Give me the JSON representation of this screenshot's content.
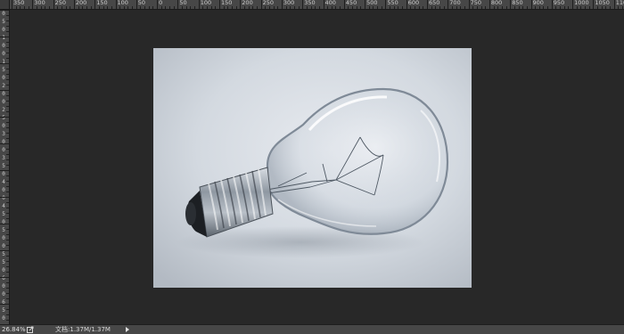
{
  "rulers": {
    "horizontal_labels": [
      "350",
      "300",
      "250",
      "200",
      "150",
      "100",
      "50",
      "0",
      "50",
      "100",
      "150",
      "200",
      "250",
      "300",
      "350",
      "400",
      "450",
      "500",
      "550",
      "600",
      "650",
      "700",
      "750",
      "800",
      "850",
      "900",
      "950",
      "1000",
      "1050",
      "1100"
    ],
    "vertical_labels": [
      "0",
      "5",
      "0",
      "1",
      "0",
      "0",
      "1",
      "5",
      "0",
      "2",
      "0",
      "0",
      "2",
      "5",
      "0",
      "3",
      "0",
      "0",
      "3",
      "5",
      "0",
      "4",
      "0",
      "0",
      "4",
      "5",
      "0",
      "5",
      "0",
      "0",
      "5",
      "5",
      "0",
      "6",
      "0",
      "0",
      "6",
      "5",
      "0"
    ]
  },
  "status_bar": {
    "zoom": "26.84%",
    "doc_label": "文档:",
    "doc_size": "1.37M/1.37M"
  },
  "icons": {
    "export": "export-icon",
    "info_menu": "play-arrow-icon"
  },
  "colors": {
    "workspace": "#282828",
    "ruler": "#474747",
    "status_bar": "#474747"
  }
}
